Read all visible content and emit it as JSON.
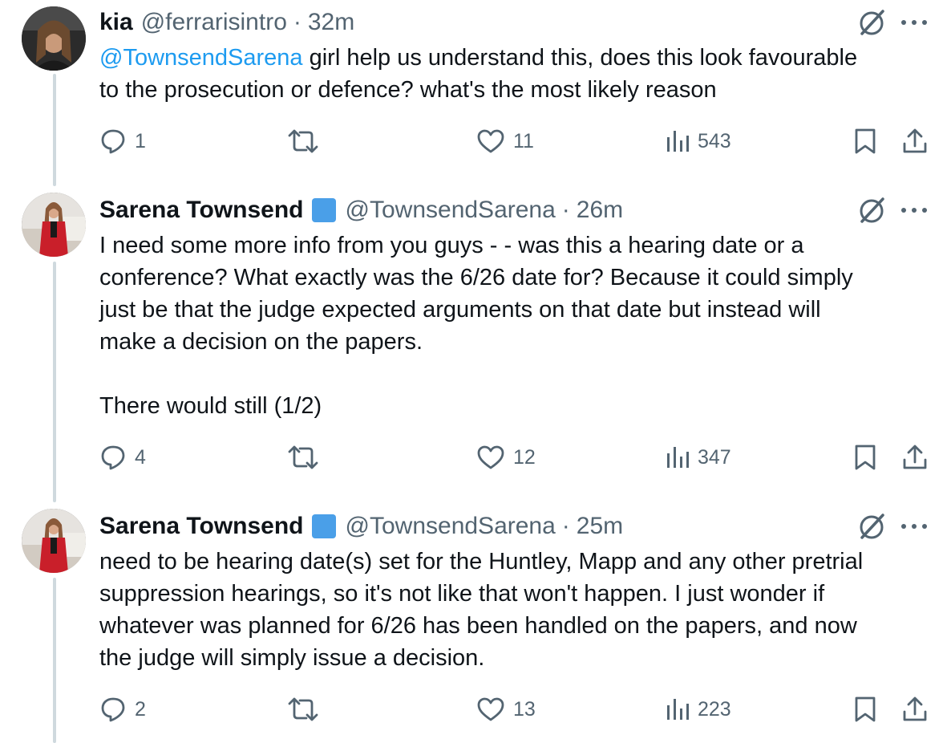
{
  "tweets": [
    {
      "name": "kia",
      "verified": false,
      "handle": "@ferrarisintro",
      "time": "32m",
      "mention": "@TownsendSarena",
      "text": " girl help us understand this, does this look favourable\nto the prosecution or defence? what's the most likely reason",
      "replies": "1",
      "retweets": "",
      "likes": "11",
      "views": "543"
    },
    {
      "name": "Sarena Townsend",
      "verified": true,
      "handle": "@TownsendSarena",
      "time": "26m",
      "mention": "",
      "text": "I need some more info from you guys - - was this a hearing date or a\nconference? What exactly was the 6/26 date for? Because it could simply\njust be that the judge expected arguments on that date but instead will\nmake a decision on the papers.\n\nThere would still (1/2)",
      "replies": "4",
      "retweets": "",
      "likes": "12",
      "views": "347"
    },
    {
      "name": "Sarena Townsend",
      "verified": true,
      "handle": "@TownsendSarena",
      "time": "25m",
      "mention": "",
      "text": "need to be hearing date(s) set for the Huntley, Mapp and any other pretrial\nsuppression hearings, so it's not like that won't happen. I just wonder if\nwhatever was planned for 6/26 has been handled on the papers, and now\nthe judge will simply issue a decision.",
      "replies": "2",
      "retweets": "",
      "likes": "13",
      "views": "223"
    }
  ],
  "separator": "·",
  "colors": {
    "text": "#0f1419",
    "muted": "#536471",
    "link": "#1d9bf0",
    "verified_badge": "#4a9fe8",
    "thread_line": "#cfd9de"
  },
  "icons": [
    "reply-icon",
    "retweet-icon",
    "like-icon",
    "views-icon",
    "bookmark-icon",
    "share-icon",
    "grok-icon",
    "more-icon",
    "verified-badge-icon"
  ]
}
